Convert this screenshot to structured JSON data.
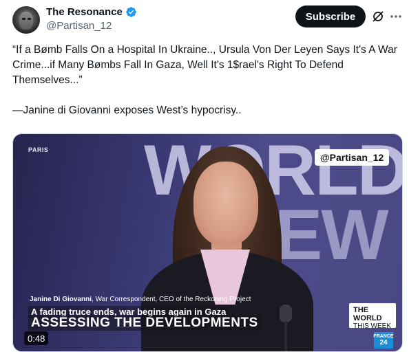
{
  "author": {
    "display_name": "The Resonance",
    "handle": "@Partisan_12",
    "verified": true
  },
  "actions": {
    "subscribe_label": "Subscribe",
    "grok_icon": "grok-slash-icon",
    "more_icon": "more-horizontal-icon"
  },
  "tweet": {
    "line1": "“If a Bømb Falls On a Hospital In Ukraine.., Ursula Von Der Leyen Says It's A War Crime...if Many Bømbs Fall In Gaza, Well It's 1$rael's Right To Defend Themselves...”",
    "line2": "—Janine di Giovanni exposes West’s hypocrisy.."
  },
  "media": {
    "location_tag": "PARIS",
    "backdrop_word1": "WORLD",
    "backdrop_word2": "EW",
    "watermark": "@Partisan_12",
    "caption_name": "Janine Di Giovanni",
    "caption_role": ", War Correspondent, CEO of the Reckoning Project",
    "headline": "A fading truce ends, war begins again in Gaza",
    "title": "ASSESSING THE DEVELOPMENTS",
    "show_badge_line1": "THE WORLD",
    "show_badge_line2": "THIS WEEK",
    "channel_logo_line1": "FRANCE",
    "channel_logo_line2": "24",
    "duration": "0:48"
  },
  "colors": {
    "accent_verified": "#1d9bf0",
    "subscribe_bg": "#0f1419",
    "secondary_text": "#536471"
  }
}
